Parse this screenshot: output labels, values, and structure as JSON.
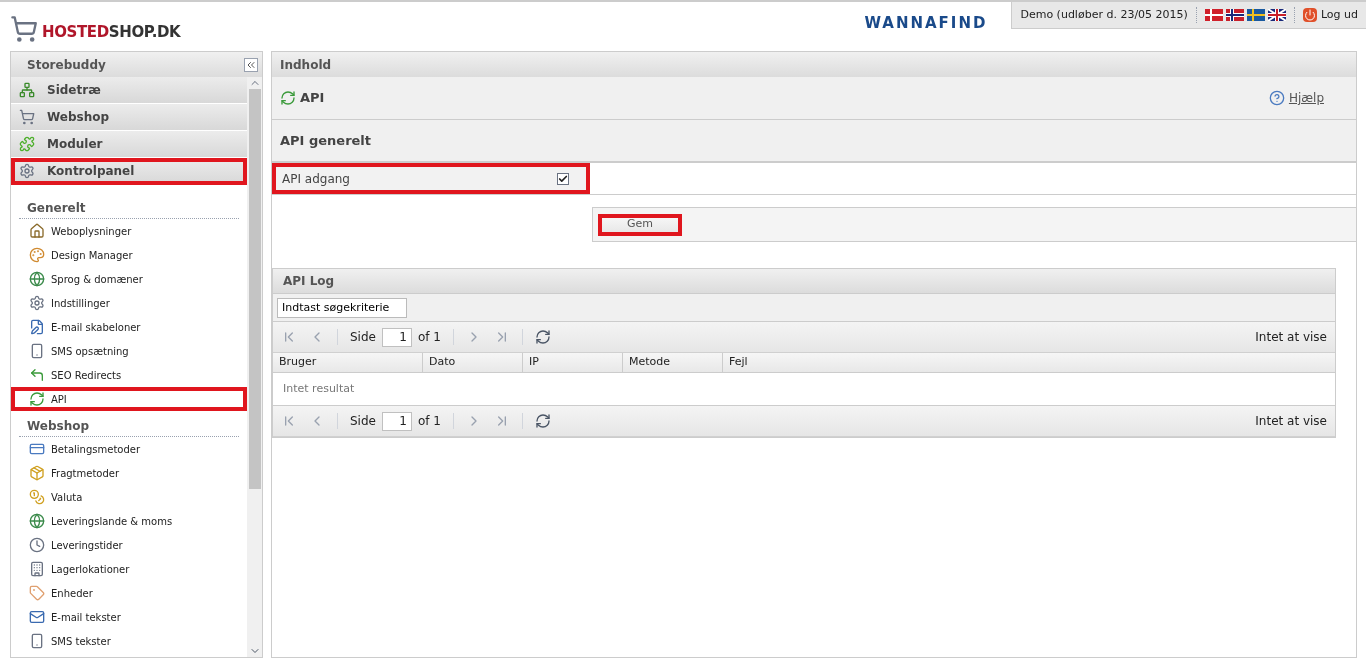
{
  "logo": {
    "part_red": "HOSTED",
    "part_dark": "SHOP.DK"
  },
  "partner_logo": "WANNAFIND",
  "account": {
    "label": "Demo (udløber d. 23/05 2015)",
    "logout": "Log ud"
  },
  "sidebar": {
    "title": "Storebuddy",
    "accordion": [
      {
        "label": "Sidetræ",
        "highlighted": false
      },
      {
        "label": "Webshop",
        "highlighted": false
      },
      {
        "label": "Moduler",
        "highlighted": false
      },
      {
        "label": "Kontrolpanel",
        "highlighted": true
      }
    ],
    "sections": [
      {
        "title": "Generelt",
        "items": [
          {
            "label": "Weboplysninger",
            "highlighted": false
          },
          {
            "label": "Design Manager",
            "highlighted": false
          },
          {
            "label": "Sprog & domæner",
            "highlighted": false
          },
          {
            "label": "Indstillinger",
            "highlighted": false
          },
          {
            "label": "E-mail skabeloner",
            "highlighted": false
          },
          {
            "label": "SMS opsætning",
            "highlighted": false
          },
          {
            "label": "SEO Redirects",
            "highlighted": false
          },
          {
            "label": "API",
            "highlighted": true
          }
        ]
      },
      {
        "title": "Webshop",
        "items": [
          {
            "label": "Betalingsmetoder",
            "highlighted": false
          },
          {
            "label": "Fragtmetoder",
            "highlighted": false
          },
          {
            "label": "Valuta",
            "highlighted": false
          },
          {
            "label": "Leveringslande & moms",
            "highlighted": false
          },
          {
            "label": "Leveringstider",
            "highlighted": false
          },
          {
            "label": "Lagerlokationer",
            "highlighted": false
          },
          {
            "label": "Enheder",
            "highlighted": false
          },
          {
            "label": "E-mail tekster",
            "highlighted": false
          },
          {
            "label": "SMS tekster",
            "highlighted": false
          }
        ]
      }
    ]
  },
  "main": {
    "header": "Indhold",
    "title": "API",
    "help": "Hjælp",
    "section_title": "API generelt",
    "fields": [
      {
        "label": "API adgang",
        "checked": true,
        "highlighted": true
      }
    ],
    "save_button": {
      "label": "Gem",
      "highlighted": true
    },
    "log": {
      "title": "API Log",
      "search": {
        "placeholder": "Indtast søgekriterie"
      },
      "pagers": [
        {
          "page_label": "Side",
          "page": "1",
          "of": "of 1",
          "status": "Intet at vise"
        },
        {
          "page_label": "Side",
          "page": "1",
          "of": "of 1",
          "status": "Intet at vise"
        }
      ],
      "columns": [
        "Bruger",
        "Dato",
        "IP",
        "Metode",
        "Fejl"
      ],
      "empty": "Intet resultat"
    }
  }
}
